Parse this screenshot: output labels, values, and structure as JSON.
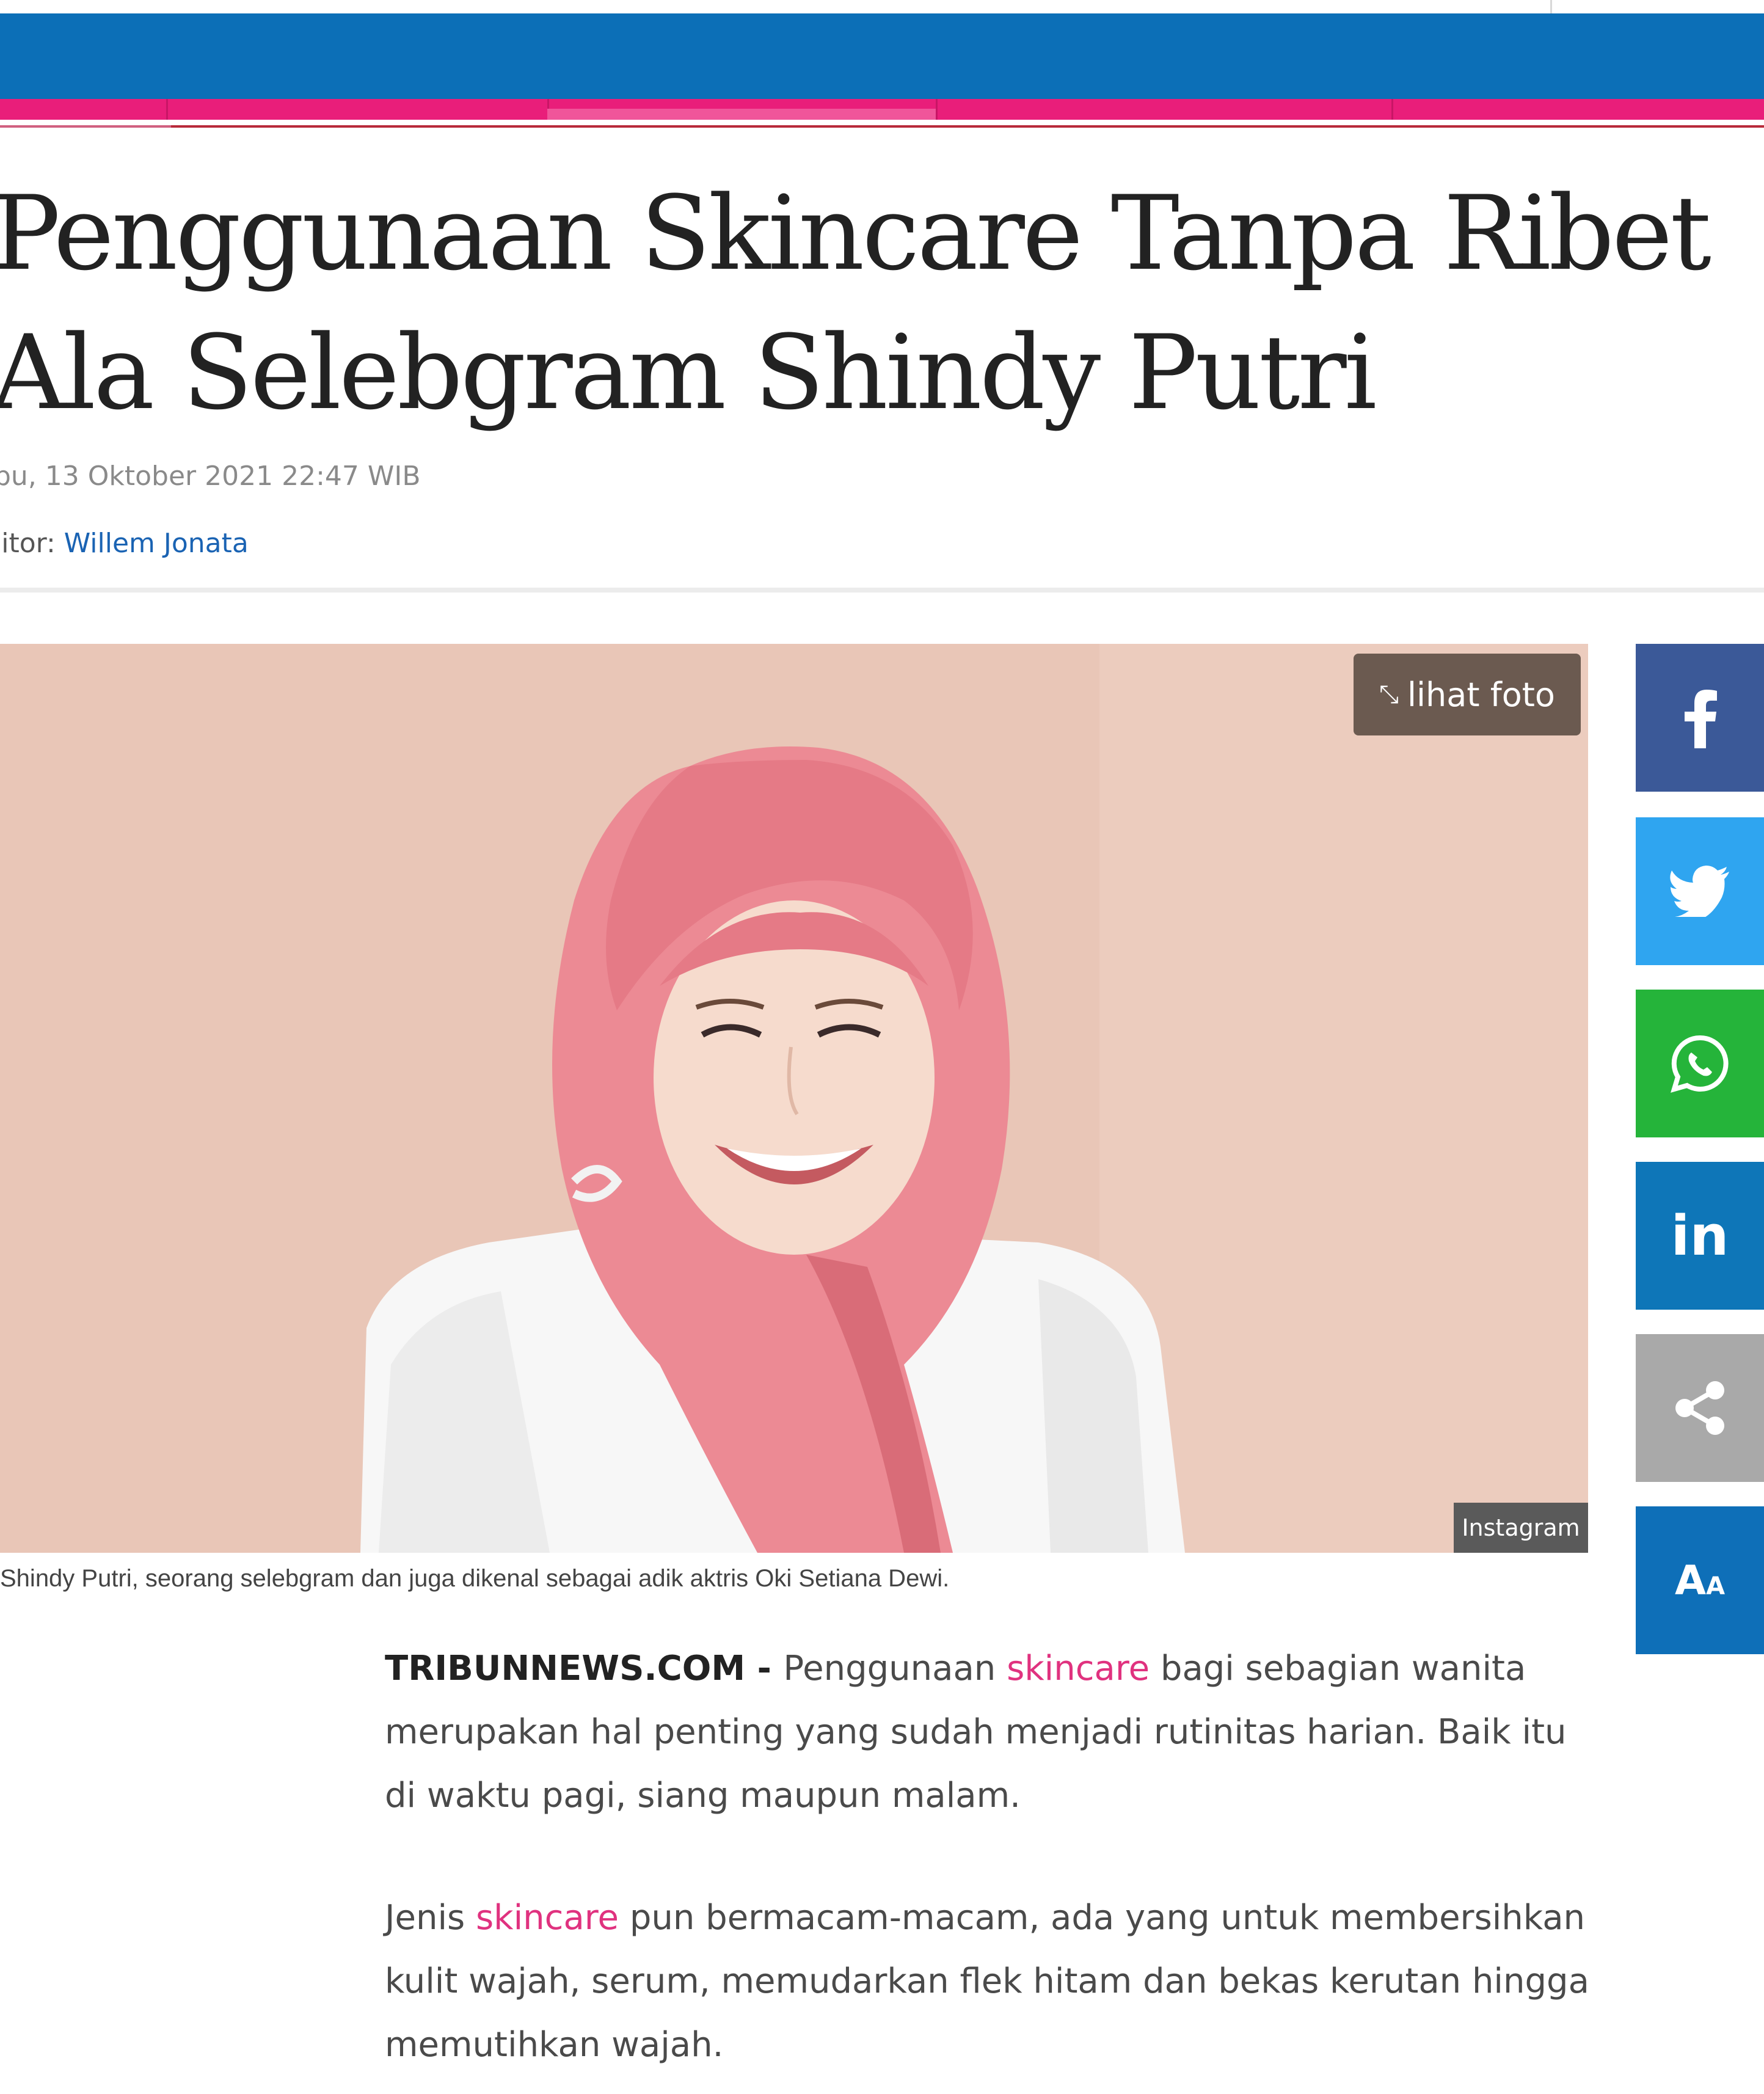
{
  "header": {
    "brand_colors": {
      "blue": "#0c6fb7",
      "pink": "#e91e7a"
    }
  },
  "article": {
    "title": "Penggunaan Skincare Tanpa Ribet Ala Selebgram Shindy Putri",
    "date": "bu, 13 Oktober 2021 22:47 WIB",
    "editor_label": "litor: ",
    "editor_name": "Willem Jonata",
    "photo": {
      "view_label": "lihat foto",
      "credit": "Instagram",
      "caption": "Shindy Putri, seorang selebgram dan juga dikenal sebagai adik aktris Oki Setiana Dewi."
    },
    "paragraphs": [
      {
        "source": "TRIBUNNEWS.COM - ",
        "before": "Penggunaan ",
        "keyword": "skincare",
        "after": " bagi sebagian wanita merupakan hal penting yang sudah menjadi rutinitas harian. Baik itu di waktu pagi, siang maupun malam."
      },
      {
        "before": "Jenis ",
        "keyword": "skincare",
        "after": " pun bermacam-macam, ada yang untuk membersihkan kulit wajah, serum, memudarkan flek hitam dan bekas kerutan hingga memutihkan wajah."
      }
    ]
  },
  "share": {
    "buttons": [
      {
        "icon": "facebook-icon",
        "color": "#3b5998"
      },
      {
        "icon": "twitter-icon",
        "color": "#2fa5f0"
      },
      {
        "icon": "whatsapp-icon",
        "color": "#25b43a"
      },
      {
        "icon": "linkedin-icon",
        "color": "#0e76b8"
      },
      {
        "icon": "share-icon",
        "color": "#a9a9a9"
      },
      {
        "icon": "font-size-icon",
        "color": "#0e6fb8"
      }
    ],
    "linkedin_glyph": "in",
    "fontsize_glyph_big": "A",
    "fontsize_glyph_small": "A"
  }
}
